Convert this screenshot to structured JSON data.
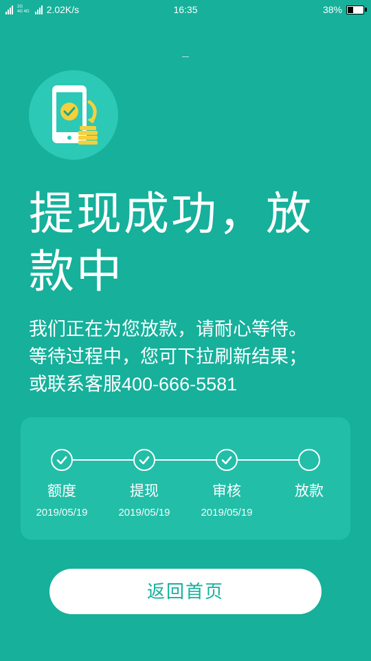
{
  "status_bar": {
    "net_small_top": "2G",
    "net_small_mid": "4G 4G",
    "speed": "2.02K/s",
    "time": "16:35",
    "battery_percent": "38%",
    "battery_level": 0.38
  },
  "hero": {
    "icon": "phone-check-coins-icon"
  },
  "title": "提现成功，放款中",
  "description": {
    "line1": "我们正在为您放款，请耐心等待。",
    "line2": "等待过程中，您可下拉刷新结果；",
    "line3": "或联系客服400-666-5581"
  },
  "steps": [
    {
      "label": "额度",
      "date": "2019/05/19",
      "done": true
    },
    {
      "label": "提现",
      "date": "2019/05/19",
      "done": true
    },
    {
      "label": "审核",
      "date": "2019/05/19",
      "done": true
    },
    {
      "label": "放款",
      "date": "",
      "done": false
    }
  ],
  "actions": {
    "home_button": "返回首页"
  },
  "colors": {
    "background": "#16B09B",
    "card": "#22BEA8",
    "icon_circle": "#2BC9B6",
    "accent": "#FFFFFF"
  }
}
